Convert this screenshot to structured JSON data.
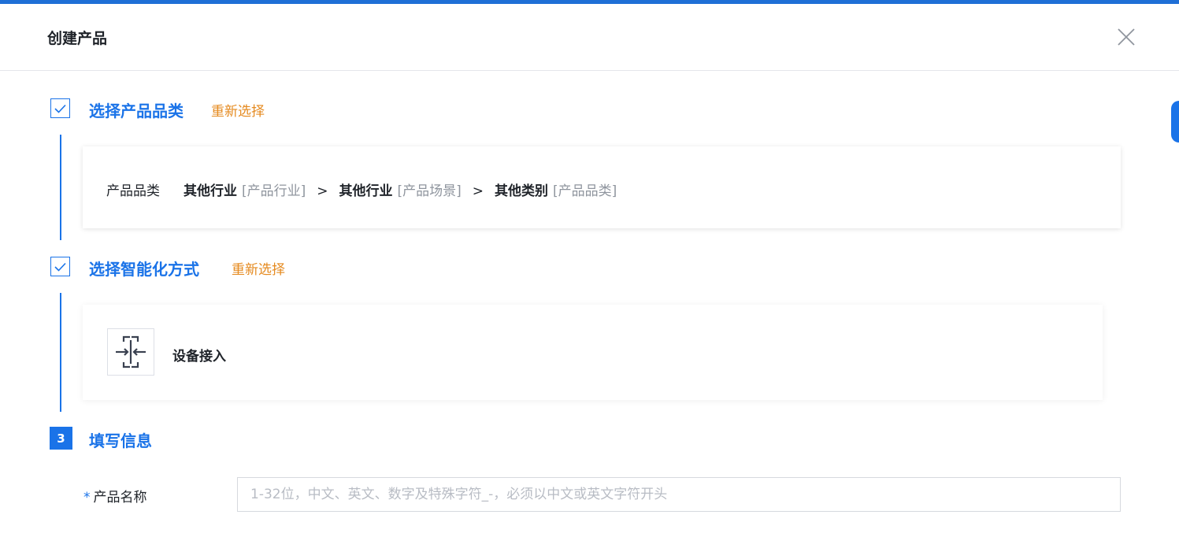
{
  "dialog": {
    "title": "创建产品"
  },
  "steps": [
    {
      "title": "选择产品品类",
      "reselect": "重新选择",
      "category": {
        "label": "产品品类",
        "path": [
          {
            "value": "其他行业",
            "type": "[产品行业]"
          },
          {
            "value": "其他行业",
            "type": "[产品场景]"
          },
          {
            "value": "其他类别",
            "type": "[产品品类]"
          }
        ],
        "separator": ">"
      }
    },
    {
      "title": "选择智能化方式",
      "reselect": "重新选择",
      "mode": {
        "label": "设备接入",
        "icon": "device-access-icon"
      }
    },
    {
      "number": "3",
      "title": "填写信息"
    }
  ],
  "form": {
    "product_name": {
      "required_mark": "*",
      "label": "产品名称",
      "value": "",
      "placeholder": "1-32位，中文、英文、数字及特殊字符_-，必须以中文或英文字符开头"
    }
  },
  "colors": {
    "accent": "#1a73e8",
    "reselect": "#e58a1f"
  }
}
